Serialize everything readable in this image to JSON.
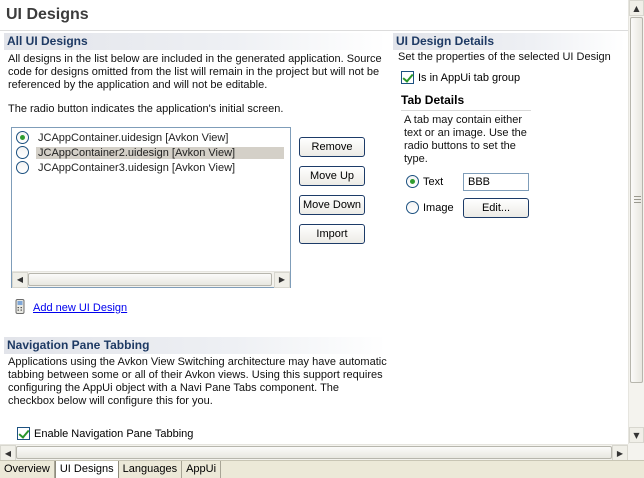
{
  "page": {
    "title": "UI Designs"
  },
  "all_designs": {
    "header": "All UI Designs",
    "description": "All designs in the list below are included in the generated application. Source code for designs omitted from the list will remain in the project but will not be referenced by the application and will not be editable.",
    "note": "The radio button indicates the application's initial screen.",
    "items": [
      {
        "label": "JCAppContainer.uidesign [Avkon View]",
        "initial": true,
        "selected": false
      },
      {
        "label": "JCAppContainer2.uidesign [Avkon View]",
        "initial": false,
        "selected": true
      },
      {
        "label": "JCAppContainer3.uidesign [Avkon View]",
        "initial": false,
        "selected": false
      }
    ],
    "buttons": {
      "remove": "Remove",
      "move_up": "Move Up",
      "move_down": "Move Down",
      "import": "Import"
    },
    "add_link": "Add new UI Design"
  },
  "details": {
    "header": "UI Design Details",
    "description": "Set the properties of the selected UI Design",
    "tab_group_checkbox": {
      "label": "Is in AppUi tab group",
      "checked": true
    },
    "tab_details": {
      "header": "Tab Details",
      "description": "A tab may contain either text or an image. Use the radio buttons to set the type.",
      "text_radio": {
        "label": "Text",
        "selected": true
      },
      "text_value": "BBB",
      "image_radio": {
        "label": "Image",
        "selected": false
      },
      "edit_button": "Edit..."
    }
  },
  "navigation": {
    "header": "Navigation Pane Tabbing",
    "description": "Applications using the Avkon View Switching architecture may have automatic tabbing between some or all of their Avkon views. Using this support requires configuring the AppUi object with a Navi Pane Tabs component. The checkbox below will configure this for you.",
    "enable_checkbox": {
      "label": "Enable Navigation Pane Tabbing",
      "checked": true
    }
  },
  "tabs": [
    {
      "label": "Overview",
      "active": false
    },
    {
      "label": "UI Designs",
      "active": true
    },
    {
      "label": "Languages",
      "active": false
    },
    {
      "label": "AppUi",
      "active": false
    }
  ]
}
